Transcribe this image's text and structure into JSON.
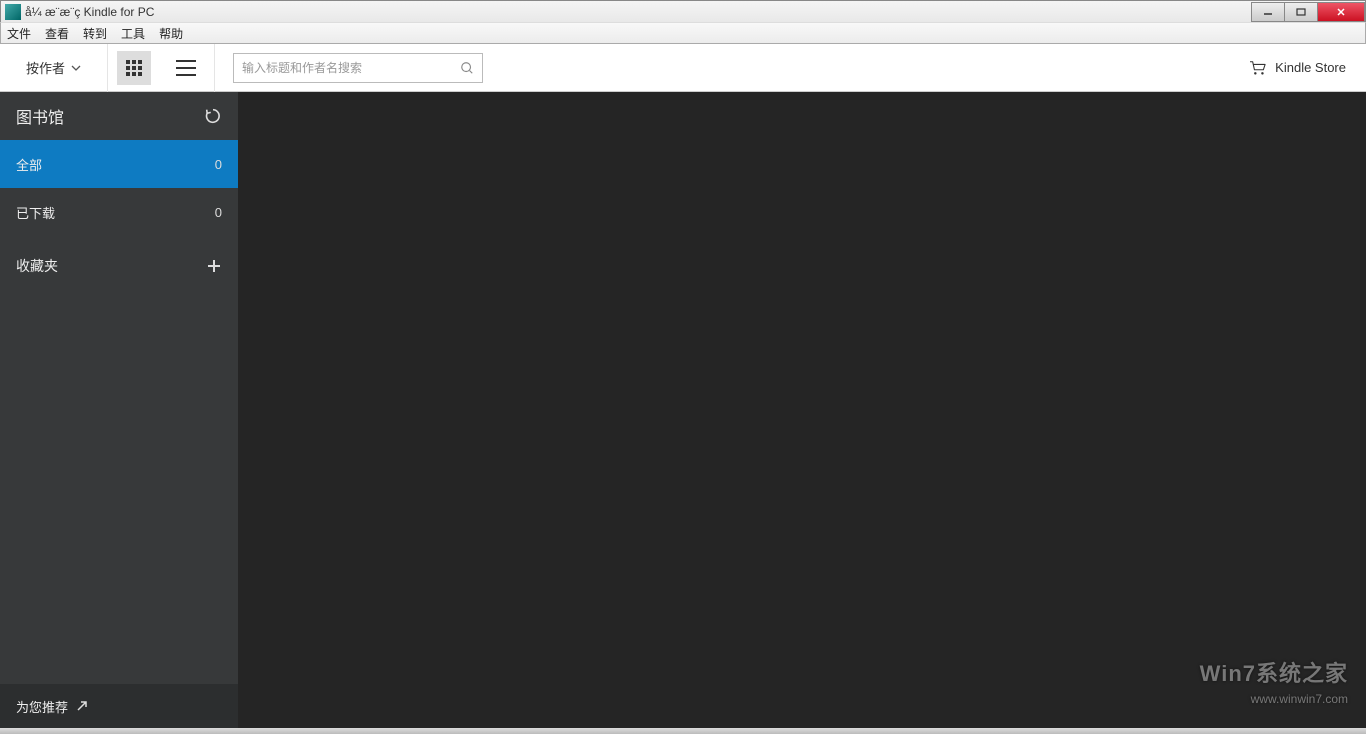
{
  "titlebar": {
    "text": "å¼ æ¨æ¨ç Kindle for PC"
  },
  "menu": {
    "file": "文件",
    "view": "查看",
    "goto": "转到",
    "tools": "工具",
    "help": "帮助"
  },
  "toolbar": {
    "sort_label": "按作者",
    "search_placeholder": "输入标题和作者名搜索",
    "store_label": "Kindle Store"
  },
  "sidebar": {
    "library_title": "图书馆",
    "items": [
      {
        "label": "全部",
        "count": "0",
        "active": true
      },
      {
        "label": "已下载",
        "count": "0",
        "active": false
      }
    ],
    "collections_label": "收藏夹",
    "footer_label": "为您推荐"
  },
  "watermark": {
    "line1": "Win7系统之家",
    "line2": "www.winwin7.com"
  }
}
